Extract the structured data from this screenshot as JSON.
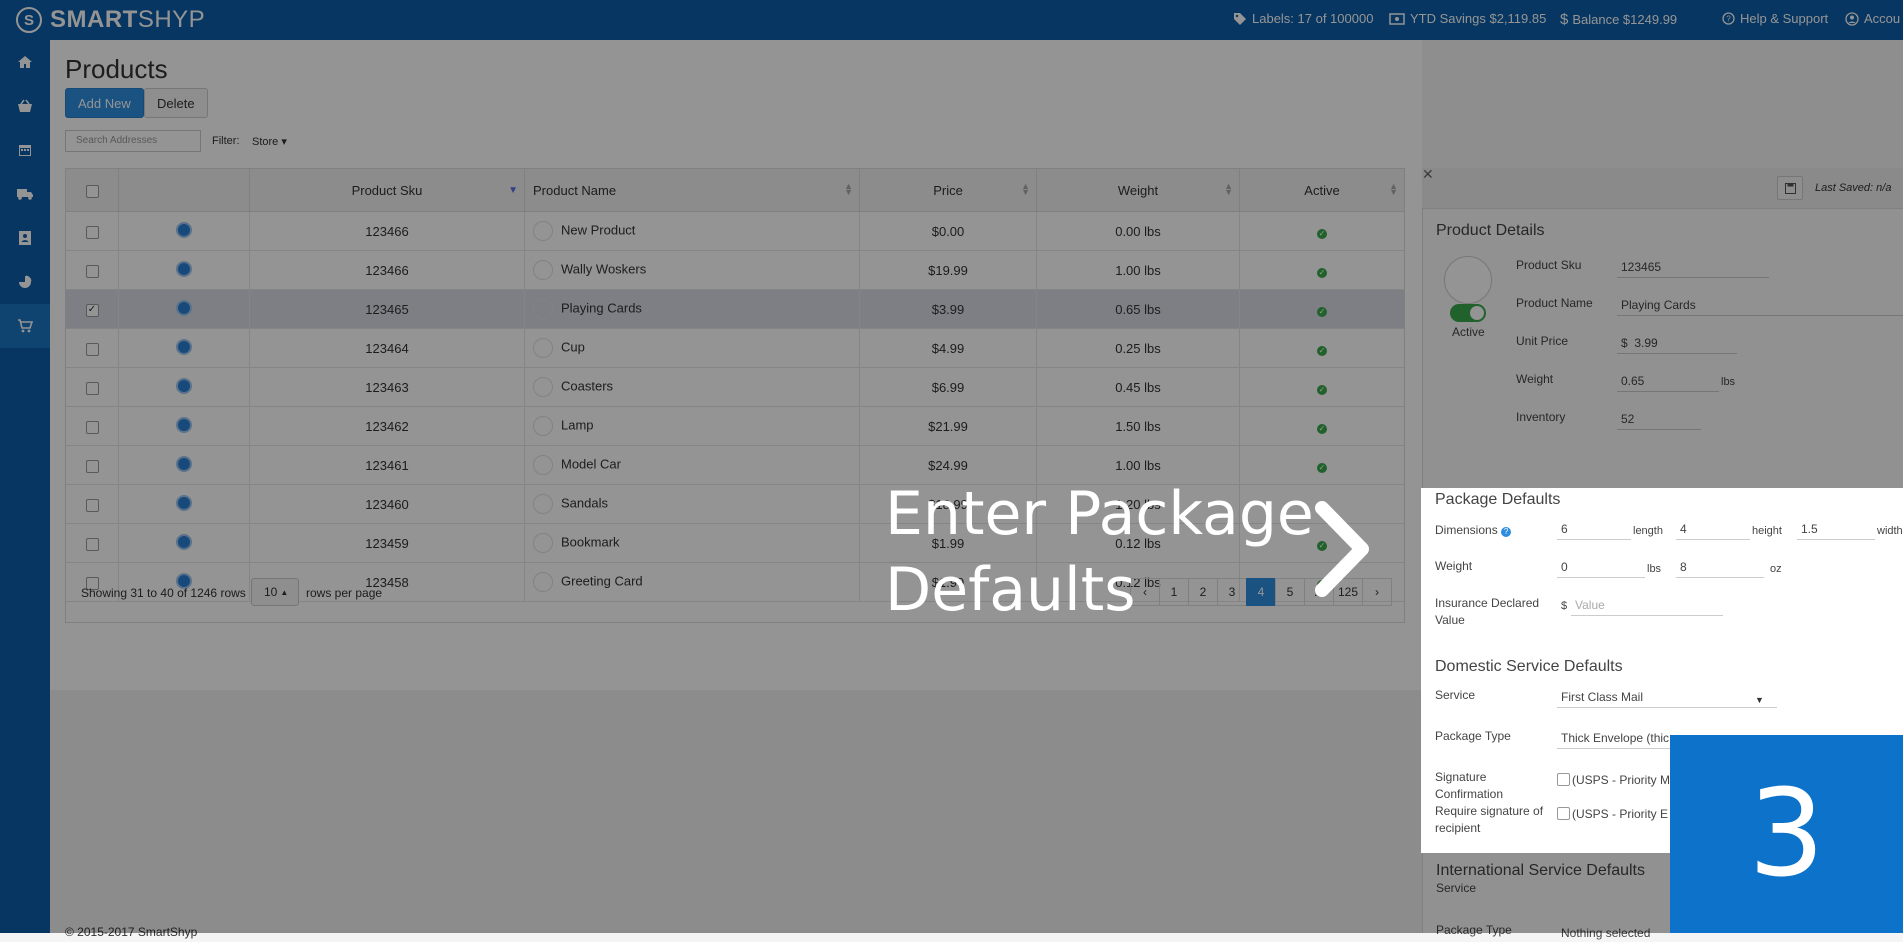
{
  "topbar": {
    "brand_a": "SMART",
    "brand_b": "SHYP",
    "labels": "Labels: 17 of 100000",
    "ytd": "YTD Savings $2,119.85",
    "balance": "Balance $1249.99",
    "help": "Help & Support",
    "account": "Accou"
  },
  "sidebar": {
    "items": [
      "home-icon",
      "store-icon",
      "calendar-icon",
      "truck-icon",
      "address-book-icon",
      "chart-pie-icon",
      "cart-icon"
    ]
  },
  "page": {
    "title": "Products",
    "add_new": "Add New",
    "delete": "Delete",
    "search_placeholder": "Search Addresses",
    "filter_label": "Filter:",
    "filter_value": "Store"
  },
  "table": {
    "headers": [
      "Product Sku",
      "Product Name",
      "Price",
      "Weight",
      "Active"
    ],
    "rows": [
      {
        "sku": "123466",
        "name": "New Product",
        "price": "$0.00",
        "weight": "0.00 lbs",
        "checked": false
      },
      {
        "sku": "123466",
        "name": "Wally Woskers",
        "price": "$19.99",
        "weight": "1.00 lbs",
        "checked": false
      },
      {
        "sku": "123465",
        "name": "Playing Cards",
        "price": "$3.99",
        "weight": "0.65 lbs",
        "checked": true
      },
      {
        "sku": "123464",
        "name": "Cup",
        "price": "$4.99",
        "weight": "0.25 lbs",
        "checked": false
      },
      {
        "sku": "123463",
        "name": "Coasters",
        "price": "$6.99",
        "weight": "0.45 lbs",
        "checked": false
      },
      {
        "sku": "123462",
        "name": "Lamp",
        "price": "$21.99",
        "weight": "1.50 lbs",
        "checked": false
      },
      {
        "sku": "123461",
        "name": "Model Car",
        "price": "$24.99",
        "weight": "1.00 lbs",
        "checked": false
      },
      {
        "sku": "123460",
        "name": "Sandals",
        "price": "$18.99",
        "weight": "1.20 lbs",
        "checked": false
      },
      {
        "sku": "123459",
        "name": "Bookmark",
        "price": "$1.99",
        "weight": "0.12 lbs",
        "checked": false
      },
      {
        "sku": "123458",
        "name": "Greeting Card",
        "price": "$1.99",
        "weight": "0.12 lbs",
        "checked": false
      }
    ],
    "showing": "Showing 31 to 40 of 1246 rows",
    "per_page": "10",
    "rows_per_page": "rows per page",
    "pages": [
      "‹",
      "1",
      "2",
      "3",
      "4",
      "5",
      "...",
      "125",
      "›"
    ],
    "active_page": "4"
  },
  "footer": {
    "copyright": "© 2015-2017 SmartShyp"
  },
  "panel": {
    "last_saved": "Last Saved: n/a",
    "product_details": "Product Details",
    "active": "Active",
    "sku_label": "Product Sku",
    "sku": "123465",
    "name_label": "Product Name",
    "name": "Playing Cards",
    "price_label": "Unit Price",
    "currency": "$",
    "price": "3.99",
    "weight_label": "Weight",
    "weight": "0.65",
    "weight_unit": "lbs",
    "inventory_label": "Inventory",
    "inventory": "52",
    "package_defaults": "Package Defaults",
    "dimensions_label": "Dimensions",
    "length": "6",
    "length_unit": "length",
    "height": "4",
    "height_unit": "height",
    "width": "1.5",
    "width_unit": "width",
    "pkg_weight_label": "Weight",
    "lbs": "0",
    "lbs_unit": "lbs",
    "oz": "8",
    "oz_unit": "oz",
    "insurance_label": "Insurance Declared Value",
    "insurance_currency": "$",
    "insurance_placeholder": "Value",
    "domestic": "Domestic Service Defaults",
    "service_label": "Service",
    "service_value": "First Class Mail",
    "package_type_label": "Package Type",
    "package_type_value": "Thick Envelope (thic",
    "signature_label": "Signature Confirmation",
    "signature_text": "(USPS - Priority M",
    "require_label": "Require signature of recipient",
    "require_text": "(USPS - Priority E",
    "international": "International Service Defaults",
    "intl_service_label": "Service",
    "intl_package_type_label": "Package Type",
    "intl_package_type_value": "Nothing selected"
  },
  "overlay": {
    "line1": "Enter Package",
    "line2": "Defaults",
    "step": "3"
  },
  "colors": {
    "brand": "#0b5ea8",
    "accent": "#2d8ee0",
    "step": "#0d72c9",
    "active_green": "#3aa84a"
  }
}
